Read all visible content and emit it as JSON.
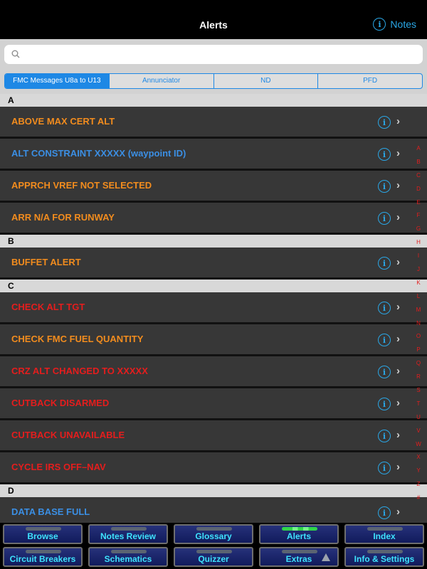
{
  "nav": {
    "title": "Alerts",
    "notes_label": "Notes"
  },
  "search": {
    "placeholder": ""
  },
  "segments": [
    "FMC Messages U8a to U13",
    "Annunciator",
    "ND",
    "PFD"
  ],
  "sections": [
    {
      "letter": "A",
      "items": [
        {
          "label": "ABOVE MAX CERT ALT",
          "color": "#f28c1e"
        },
        {
          "label": "ALT CONSTRAINT XXXXX (waypoint ID)",
          "color": "#3b8fe4"
        },
        {
          "label": "APPRCH VREF NOT SELECTED",
          "color": "#f28c1e"
        },
        {
          "label": "ARR N/A FOR RUNWAY",
          "color": "#f28c1e"
        }
      ]
    },
    {
      "letter": "B",
      "items": [
        {
          "label": "BUFFET ALERT",
          "color": "#f28c1e"
        }
      ]
    },
    {
      "letter": "C",
      "items": [
        {
          "label": "CHECK ALT TGT",
          "color": "#e51d1d"
        },
        {
          "label": "CHECK FMC FUEL QUANTITY",
          "color": "#f28c1e"
        },
        {
          "label": "CRZ ALT CHANGED TO XXXXX",
          "color": "#e51d1d"
        },
        {
          "label": "CUTBACK DISARMED",
          "color": "#e51d1d"
        },
        {
          "label": "CUTBACK UNAVAILABLE",
          "color": "#e51d1d"
        },
        {
          "label": "CYCLE IRS OFF–NAV",
          "color": "#e51d1d"
        }
      ]
    },
    {
      "letter": "D",
      "items": [
        {
          "label": "DATA BASE FULL",
          "color": "#3b8fe4"
        }
      ]
    }
  ],
  "index_letters": [
    "A",
    "B",
    "C",
    "D",
    "E",
    "F",
    "G",
    "H",
    "I",
    "J",
    "K",
    "L",
    "M",
    "N",
    "O",
    "P",
    "Q",
    "R",
    "S",
    "T",
    "U",
    "V",
    "W",
    "X",
    "Y",
    "Z",
    "#"
  ],
  "tabs": [
    {
      "label": "Browse",
      "active": false
    },
    {
      "label": "Notes Review",
      "active": false
    },
    {
      "label": "Glossary",
      "active": false
    },
    {
      "label": "Alerts",
      "active": true
    },
    {
      "label": "Index",
      "active": false
    },
    {
      "label": "Circuit Breakers",
      "active": false
    },
    {
      "label": "Schematics",
      "active": false
    },
    {
      "label": "Quizzer",
      "active": false
    },
    {
      "label": "Extras",
      "active": false,
      "arrow": true
    },
    {
      "label": "Info & Settings",
      "active": false
    }
  ],
  "colors": {
    "accent": "#1e88e5",
    "tab_text": "#3ee3ff",
    "orange": "#f28c1e",
    "red": "#e51d1d",
    "blue": "#3b8fe4"
  }
}
